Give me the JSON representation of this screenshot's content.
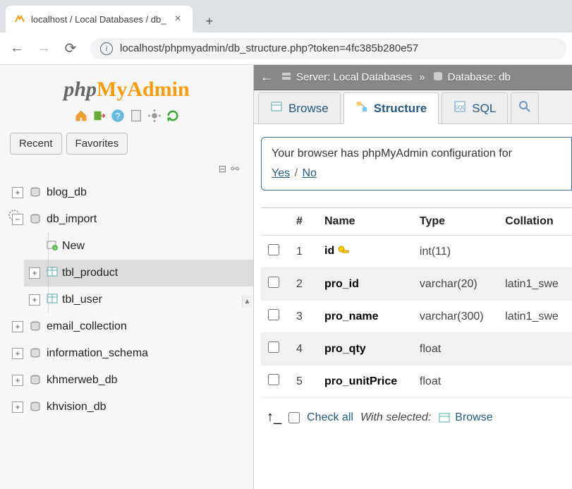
{
  "browser": {
    "tab_title": "localhost / Local Databases / db_",
    "url": "localhost/phpmyadmin/db_structure.php?token=4fc385b280e57"
  },
  "logo": {
    "part1": "php",
    "part2": "MyAdmin"
  },
  "sidebar_tabs": {
    "recent": "Recent",
    "favorites": "Favorites"
  },
  "tree": {
    "blog_db": "blog_db",
    "db_import": "db_import",
    "new": "New",
    "tbl_product": "tbl_product",
    "tbl_user": "tbl_user",
    "email_collection": "email_collection",
    "information_schema": "information_schema",
    "khmerweb_db": "khmerweb_db",
    "khvision_db": "khvision_db"
  },
  "breadcrumb": {
    "server_label": "Server: Local Databases",
    "db_label": "Database: db",
    "sep": "»"
  },
  "tabs": {
    "browse": "Browse",
    "structure": "Structure",
    "sql": "SQL"
  },
  "notice": {
    "text": "Your browser has phpMyAdmin configuration for",
    "yes": "Yes",
    "no": "No",
    "slash": "/"
  },
  "columns": {
    "num": "#",
    "name": "Name",
    "type": "Type",
    "collation": "Collation"
  },
  "rows": [
    {
      "num": "1",
      "name": "id",
      "type": "int(11)",
      "collation": "",
      "pk": true
    },
    {
      "num": "2",
      "name": "pro_id",
      "type": "varchar(20)",
      "collation": "latin1_swe",
      "pk": false
    },
    {
      "num": "3",
      "name": "pro_name",
      "type": "varchar(300)",
      "collation": "latin1_swe",
      "pk": false
    },
    {
      "num": "4",
      "name": "pro_qty",
      "type": "float",
      "collation": "",
      "pk": false
    },
    {
      "num": "5",
      "name": "pro_unitPrice",
      "type": "float",
      "collation": "",
      "pk": false
    }
  ],
  "footer": {
    "check_all": "Check all",
    "with_selected": "With selected:",
    "browse": "Browse"
  }
}
